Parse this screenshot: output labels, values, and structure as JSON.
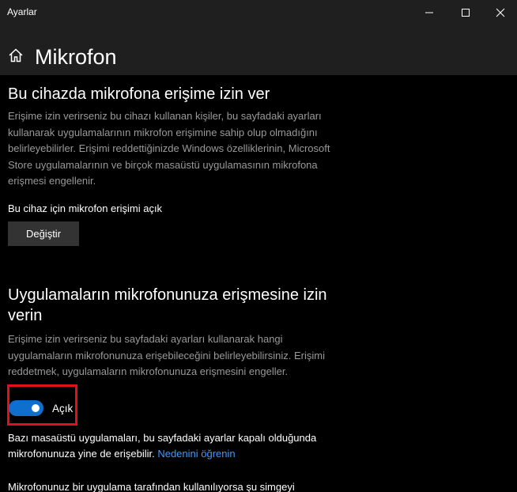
{
  "window": {
    "app_title": "Ayarlar"
  },
  "header": {
    "title": "Mikrofon"
  },
  "device_section": {
    "heading": "Bu cihazda mikrofona erişime izin ver",
    "description_lines": [
      "Erişime izin verirseniz bu cihazı kullanan kişiler, bu sayfadaki ayarları",
      "kullanarak uygulamalarının mikrofon erişimine sahip olup olmadığını",
      "belirleyebilirler. Erişimi reddettiğinizde Windows özelliklerinin, Microsoft",
      "Store uygulamalarının ve birçok masaüstü uygulamasının mikrofona",
      "erişmesi engellenir."
    ],
    "status": "Bu cihaz için mikrofon erişimi açık",
    "change_button": "Değiştir"
  },
  "apps_section": {
    "heading_lines": [
      "Uygulamaların mikrofonunuza erişmesine izin",
      "verin"
    ],
    "description_lines": [
      "Erişime izin verirseniz bu sayfadaki ayarları kullanarak hangi",
      "uygulamaların mikrofonunuza erişebileceğini belirleyebilirsiniz. Erişimi",
      "reddetmek, uygulamaların mikrofonunuza erişmesini engeller."
    ],
    "toggle": {
      "state_label": "Açık",
      "on": true
    },
    "note_line1": "Bazı masaüstü uygulamaları, bu sayfadaki ayarlar kapalı olduğunda",
    "note_line2": "mikrofonunuza yine de erişebilir.",
    "note_link": "Nedenini öğrenin",
    "bottom_text": "Mikrofonunuz bir uygulama tarafından kullanılıyorsa şu simgeyi"
  },
  "colors": {
    "background": "#000000",
    "header_bg": "#1f1f1f",
    "accent": "#0f6fcf",
    "link": "#3b9cff",
    "highlight": "#e0111b",
    "muted_text": "#999999"
  },
  "icons": {
    "home": "home-icon",
    "minimize": "minimize-icon",
    "maximize": "maximize-icon",
    "close": "close-icon"
  }
}
